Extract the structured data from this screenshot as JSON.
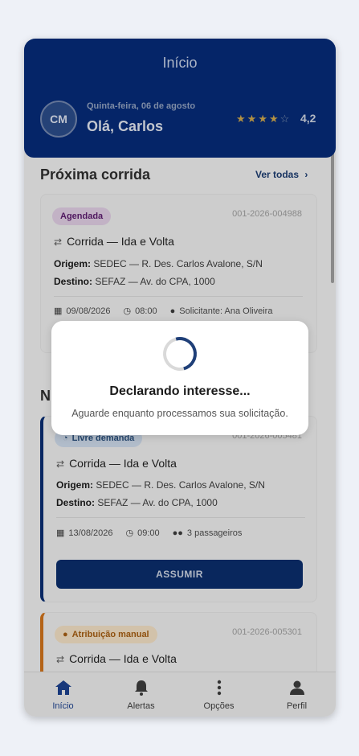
{
  "header": {
    "title": "Início",
    "avatar_initials": "CM",
    "date": "Quinta-feira, 06 de agosto",
    "greeting": "Olá, Carlos",
    "stars_filled": 4,
    "stars_total": 5,
    "rating": "4,2"
  },
  "next_trip": {
    "section_title": "Próxima corrida",
    "see_all": "Ver todas",
    "badge": "Agendada",
    "code": "001-2026-004988",
    "title": "Corrida — Ida e Volta",
    "origin_label": "Origem:",
    "origin": "SEDEC — R. Des. Carlos Avalone, S/N",
    "dest_label": "Destino:",
    "dest": "SEFAZ — Av. do CPA, 1000",
    "date": "09/08/2026",
    "time": "08:00",
    "requester": "Solicitante: Ana Oliveira"
  },
  "section2": {
    "title_visible": "N"
  },
  "card_free": {
    "badge": "Livre demanda",
    "code": "001-2026-005481",
    "title": "Corrida — Ida e Volta",
    "origin_label": "Origem:",
    "origin": "SEDEC — R. Des. Carlos Avalone, S/N",
    "dest_label": "Destino:",
    "dest": "SEFAZ — Av. do CPA, 1000",
    "date": "13/08/2026",
    "time": "09:00",
    "passengers": "3 passageiros",
    "button": "ASSUMIR"
  },
  "card_manual": {
    "badge": "Atribuição manual",
    "code": "001-2026-005301",
    "title": "Corrida — Ida e Volta"
  },
  "dialog": {
    "title": "Declarando interesse...",
    "message": "Aguarde enquanto processamos sua solicitação."
  },
  "nav": [
    {
      "label": "Início",
      "icon": "home-icon",
      "active": true
    },
    {
      "label": "Alertas",
      "icon": "bell-icon",
      "active": false
    },
    {
      "label": "Opções",
      "icon": "more-vertical-icon",
      "active": false
    },
    {
      "label": "Perfil",
      "icon": "person-icon",
      "active": false
    }
  ],
  "colors": {
    "primary": "#062a74",
    "accent_blue": "#0a2c6e",
    "accent_orange": "#c96f1a"
  }
}
